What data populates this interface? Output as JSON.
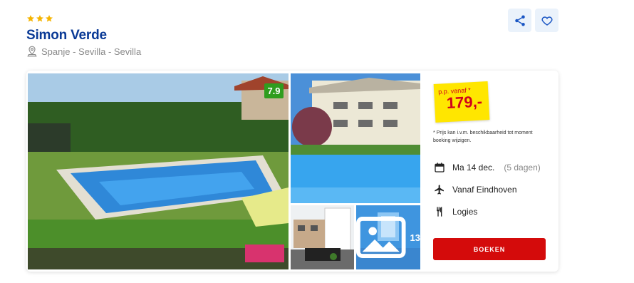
{
  "hotel": {
    "stars": 3,
    "name": "Simon Verde",
    "location": "Spanje - Sevilla - Sevilla"
  },
  "icons": {
    "location": "map-pin-icon",
    "share": "share-icon",
    "favorite": "heart-icon",
    "date": "calendar-icon",
    "departure": "airplane-icon",
    "board": "cutlery-icon",
    "gallery": "image-icon",
    "rating": "star-icon"
  },
  "gallery": {
    "rating": "7.9",
    "more_photos": "13"
  },
  "price": {
    "prefix": "p.p. vanaf *",
    "value": "179,-",
    "disclaimer": "* Prijs kan i.v.m. beschikbaarheid tot moment boeking wijzigen."
  },
  "trip": {
    "date": "Ma 14 dec.",
    "duration": "(5 dagen)",
    "departure": "Vanaf Eindhoven",
    "board": "Logies"
  },
  "actions": {
    "book_label": "BOEKEN"
  },
  "colors": {
    "brand_blue": "#0a3a96",
    "star_yellow": "#f5b400",
    "price_tag": "#ffe600",
    "price_red": "#d0021b",
    "button_red": "#d40b0b",
    "rating_green": "#2f9d1e",
    "action_bg": "#eaf2fb"
  }
}
